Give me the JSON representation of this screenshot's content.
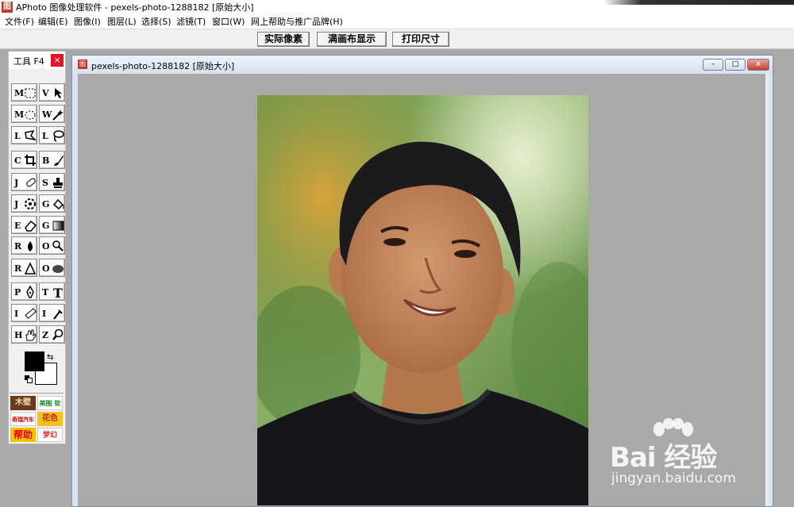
{
  "app": {
    "icon": "图",
    "title": "APhoto 图像处理软件 - pexels-photo-1288182 [原始大小]"
  },
  "menu": [
    "文件(F)",
    "编辑(E)",
    "图像(I)",
    "图层(L)",
    "选择(S)",
    "滤镜(T)",
    "窗口(W)",
    "网上帮助与推广品牌(H)"
  ],
  "toolbar": {
    "actual_pixels": "实际像素",
    "fit_canvas": "满画布显示",
    "print_size": "打印尺寸"
  },
  "tools_panel": {
    "title": "工具 F4",
    "close": "×",
    "tools": [
      {
        "key": "M",
        "icon": "rect-marquee-icon"
      },
      {
        "key": "V",
        "icon": "move-icon"
      },
      {
        "key": "M",
        "icon": "ellipse-marquee-icon"
      },
      {
        "key": "W",
        "icon": "magic-wand-icon"
      },
      {
        "key": "L",
        "icon": "polygon-lasso-icon"
      },
      {
        "key": "L",
        "icon": "lasso-icon"
      },
      {
        "key": "C",
        "icon": "crop-icon"
      },
      {
        "key": "B",
        "icon": "brush-icon"
      },
      {
        "key": "J",
        "icon": "healing-icon"
      },
      {
        "key": "S",
        "icon": "stamp-icon"
      },
      {
        "key": "J",
        "icon": "red-eye-icon"
      },
      {
        "key": "G",
        "icon": "paint-bucket-icon"
      },
      {
        "key": "E",
        "icon": "eraser-icon"
      },
      {
        "key": "G",
        "icon": "gradient-icon"
      },
      {
        "key": "R",
        "icon": "blur-icon"
      },
      {
        "key": "O",
        "icon": "dodge-icon"
      },
      {
        "key": "R",
        "icon": "sharpen-icon"
      },
      {
        "key": "O",
        "icon": "sponge-icon"
      },
      {
        "key": "P",
        "icon": "pen-icon"
      },
      {
        "key": "T",
        "icon": "text-icon"
      },
      {
        "key": "I",
        "icon": "ruler-icon"
      },
      {
        "key": "I",
        "icon": "eyedropper-icon"
      },
      {
        "key": "H",
        "icon": "hand-icon"
      },
      {
        "key": "Z",
        "icon": "zoom-icon"
      }
    ],
    "foreground_color": "#000000",
    "background_color": "#ffffff",
    "logos": [
      "木壁",
      "美图 软件",
      "奇瑞汽车",
      "花色",
      "帮助",
      "梦幻"
    ]
  },
  "document": {
    "icon": "图",
    "title": "pexels-photo-1288182 [原始大小]",
    "minimize": "–",
    "maximize": "□",
    "close": "×"
  },
  "watermark": {
    "brand": "Bai 经验",
    "url": "jingyan.baidu.com"
  },
  "colors": {
    "canvas_bg": "#a9a9a9",
    "close_red": "#e81123",
    "doc_frame": "#d9e4f1"
  }
}
